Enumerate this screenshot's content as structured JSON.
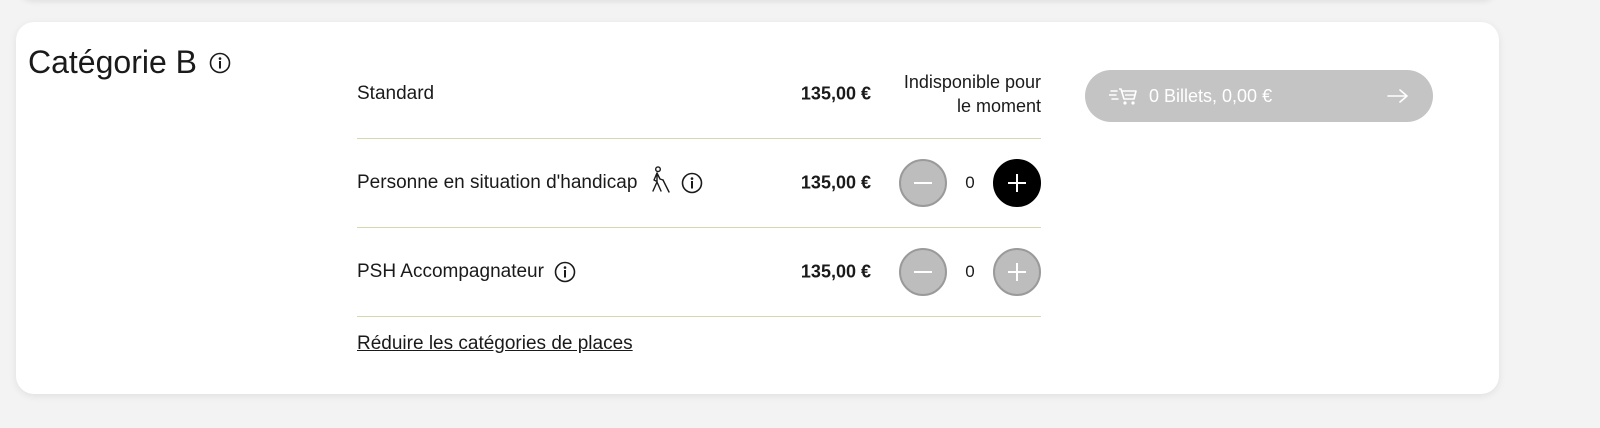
{
  "category": {
    "title": "Catégorie B"
  },
  "rows": [
    {
      "label": "Standard",
      "price": "135,00 €",
      "status": "Indisponible pour\nle moment",
      "status_line1": "Indisponible pour",
      "status_line2": "le moment"
    },
    {
      "label": "Personne en situation d'handicap",
      "price": "135,00 €",
      "quantity": "0"
    },
    {
      "label": "PSH Accompagnateur",
      "price": "135,00 €",
      "quantity": "0"
    }
  ],
  "reduce_link": "Réduire les catégories de places",
  "cart": {
    "label": "0 Billets, 0,00 €"
  },
  "colors": {
    "divider": "#d6d8b0",
    "disabled_button": "#bdbdbd",
    "active_button": "#000000",
    "cart_button": "#c4c4c4"
  },
  "icons": [
    "info-icon",
    "accessibility-icon",
    "minus-icon",
    "plus-icon",
    "cart-icon",
    "arrow-right-icon"
  ]
}
